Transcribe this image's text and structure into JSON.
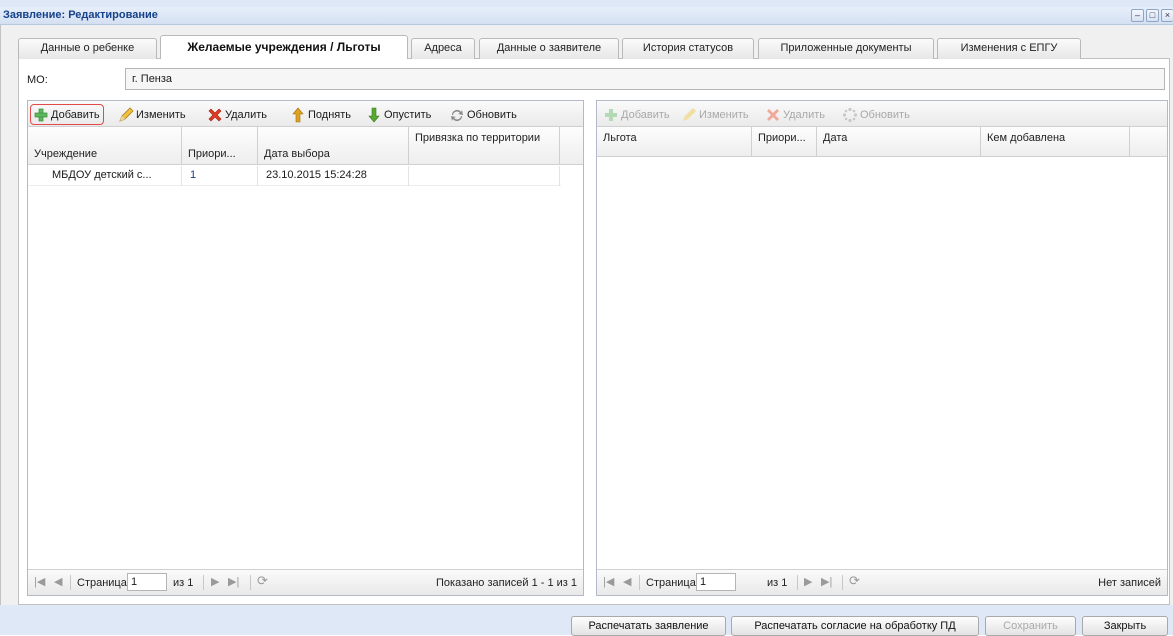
{
  "window": {
    "title": "Заявление: Редактирование",
    "controls": [
      "minimize",
      "maximize",
      "close"
    ]
  },
  "tabs": [
    {
      "label": "Данные о ребенке",
      "active": false
    },
    {
      "label": "Желаемые учреждения / Льготы",
      "active": true
    },
    {
      "label": "Адреса",
      "active": false
    },
    {
      "label": "Данные о заявителе",
      "active": false
    },
    {
      "label": "История статусов",
      "active": false
    },
    {
      "label": "Приложенные документы",
      "active": false
    },
    {
      "label": "Изменения с ЕПГУ",
      "active": false
    }
  ],
  "mo": {
    "label": "МО:",
    "value": "г. Пенза"
  },
  "left_panel": {
    "toolbar": {
      "add": "Добавить",
      "edit": "Изменить",
      "delete": "Удалить",
      "up": "Поднять",
      "down": "Опустить",
      "refresh": "Обновить"
    },
    "columns": [
      "Учреждение",
      "Приори...",
      "Дата выбора",
      "Привязка по территории"
    ],
    "rows": [
      {
        "institution": "МБДОУ детский с...",
        "priority": "1",
        "date": "23.10.2015 15:24:28",
        "binding": ""
      }
    ],
    "pager": {
      "page_label": "Страница",
      "page_value": "1",
      "of_label": "из 1",
      "status": "Показано записей 1 - 1 из 1"
    }
  },
  "right_panel": {
    "toolbar": {
      "add": "Добавить",
      "edit": "Изменить",
      "delete": "Удалить",
      "refresh": "Обновить"
    },
    "columns": [
      "Льгота",
      "Приори...",
      "Дата",
      "Кем добавлена"
    ],
    "pager": {
      "page_label": "Страница",
      "page_value": "1",
      "of_label": "из 1",
      "status": "Нет записей"
    }
  },
  "footer_buttons": {
    "print_application": "Распечатать заявление",
    "print_consent": "Распечатать согласие на обработку ПД",
    "save": "Сохранить",
    "close": "Закрыть"
  },
  "colors": {
    "title": "#15428b",
    "add_highlight": "#e24a4a",
    "add_icon": "#5cb85c",
    "delete_icon": "#e03c1f",
    "up_icon": "#e0a020",
    "down_icon": "#5aa832"
  }
}
